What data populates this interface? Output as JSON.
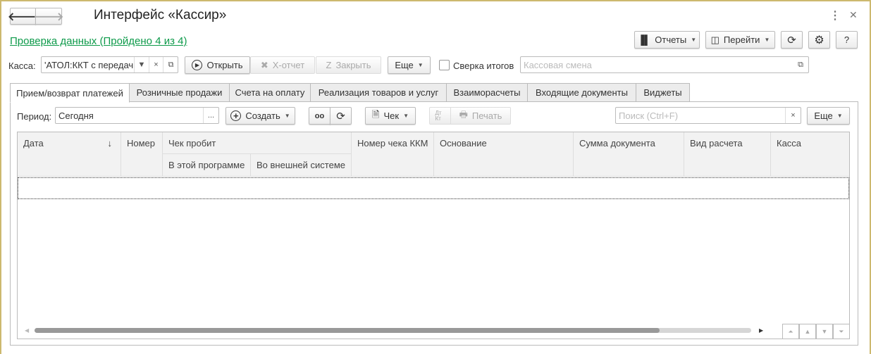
{
  "window": {
    "title": "Интерфейс «Кассир»"
  },
  "header": {
    "check_link": "Проверка данных (Пройдено 4 из 4)",
    "reports": "Отчеты",
    "goto": "Перейти",
    "help": "?"
  },
  "kassa": {
    "label": "Касса:",
    "value": "'АТОЛ:ККТ с передач",
    "open": "Открыть",
    "x_report": "X-отчет",
    "close": "Закрыть",
    "more": "Еще",
    "reconcile": "Сверка итогов",
    "shift_placeholder": "Кассовая смена"
  },
  "tabs": [
    "Прием/возврат платежей",
    "Розничные продажи",
    "Счета на оплату",
    "Реализация товаров и услуг",
    "Взаиморасчеты",
    "Входящие документы",
    "Виджеты"
  ],
  "toolbar": {
    "period_label": "Период:",
    "period_value": "Сегодня",
    "period_btn": "...",
    "create": "Создать",
    "receipt": "Чек",
    "dtkt": "Дт Кт",
    "print": "Печать",
    "search_placeholder": "Поиск (Ctrl+F)",
    "more": "Еще"
  },
  "table": {
    "columns": {
      "date": "Дата",
      "sort": "↓",
      "number": "Номер",
      "check_printed": "Чек пробит",
      "in_program": "В этой программе",
      "in_external": "Во внешней системе",
      "kkm_number": "Номер чека ККМ",
      "basis": "Основание",
      "sum": "Сумма документа",
      "payment_type": "Вид расчета",
      "kassa": "Касса"
    },
    "rows": []
  }
}
